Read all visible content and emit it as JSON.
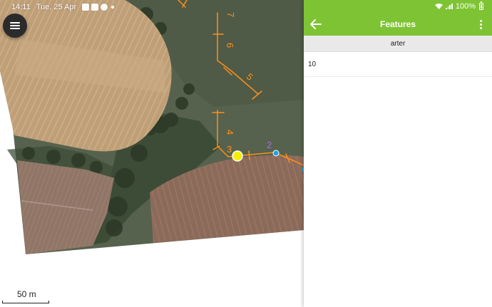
{
  "status": {
    "time": "14:11",
    "date": "Tue, 25 Apr",
    "battery": "100%"
  },
  "map": {
    "scale_label": "50 m",
    "segment_labels": [
      "7",
      "6",
      "5",
      "4",
      "3",
      "2"
    ],
    "colors": {
      "line": "#ff8f1a",
      "selected_point": "#f4ef00",
      "point": "#1aa3e8",
      "label_purple": "#a070d0"
    }
  },
  "panel": {
    "title": "Features",
    "layer_name": "arter",
    "rows": [
      {
        "value": "10"
      }
    ]
  },
  "icons": {
    "menu": "menu-icon",
    "back": "back-arrow-icon",
    "overflow": "more-vert-icon",
    "wifi": "wifi-icon",
    "signal": "signal-icon",
    "battery": "battery-icon"
  },
  "colors": {
    "accent": "#7ec333",
    "panel_header": "#e9e9e9"
  }
}
